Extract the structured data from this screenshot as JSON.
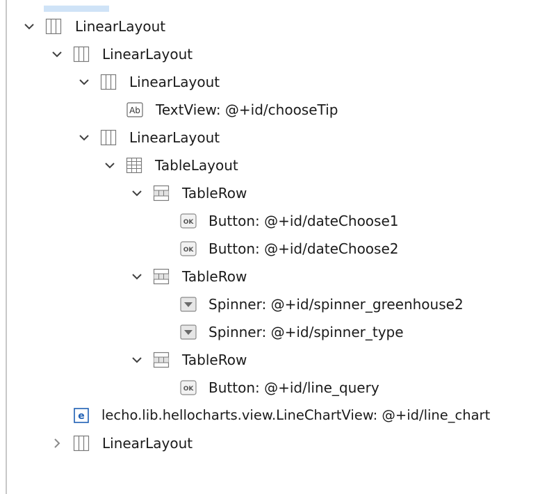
{
  "tree": {
    "nodes": [
      {
        "label": "LinearLayout",
        "icon": "linear-layout-icon",
        "depth": 0,
        "expanded": true
      },
      {
        "label": "LinearLayout",
        "icon": "linear-layout-icon",
        "depth": 1,
        "expanded": true
      },
      {
        "label": "LinearLayout",
        "icon": "linear-layout-icon",
        "depth": 2,
        "expanded": true
      },
      {
        "label": "TextView: @+id/chooseTip",
        "icon": "textview-icon",
        "depth": 3
      },
      {
        "label": "LinearLayout",
        "icon": "linear-layout-icon",
        "depth": 2,
        "expanded": true
      },
      {
        "label": "TableLayout",
        "icon": "table-layout-icon",
        "depth": 3,
        "expanded": true
      },
      {
        "label": "TableRow",
        "icon": "table-row-icon",
        "depth": 4,
        "expanded": true
      },
      {
        "label": "Button: @+id/dateChoose1",
        "icon": "button-icon",
        "depth": 5
      },
      {
        "label": "Button: @+id/dateChoose2",
        "icon": "button-icon",
        "depth": 5
      },
      {
        "label": "TableRow",
        "icon": "table-row-icon",
        "depth": 4,
        "expanded": true
      },
      {
        "label": "Spinner: @+id/spinner_greenhouse2",
        "icon": "spinner-icon",
        "depth": 5
      },
      {
        "label": "Spinner: @+id/spinner_type",
        "icon": "spinner-icon",
        "depth": 5
      },
      {
        "label": "TableRow",
        "icon": "table-row-icon",
        "depth": 4,
        "expanded": true
      },
      {
        "label": "Button: @+id/line_query",
        "icon": "button-icon",
        "depth": 5
      },
      {
        "label": "lecho.lib.hellocharts.view.LineChartView: @+id/line_chart",
        "icon": "custom-view-icon",
        "depth": 2
      },
      {
        "label": "LinearLayout",
        "icon": "linear-layout-icon",
        "depth": 1,
        "expanded": false
      }
    ],
    "icon_texts": {
      "textview": "Ab",
      "button": "OK",
      "custom_view": "e"
    },
    "colors": {
      "chevron": "#404040",
      "chevron_collapsed": "#8a8a8a",
      "icon_stroke": "#7a7a7a",
      "selection_accent": "#cfe3f7",
      "custom_view_blue": "#1e5fb4"
    }
  }
}
